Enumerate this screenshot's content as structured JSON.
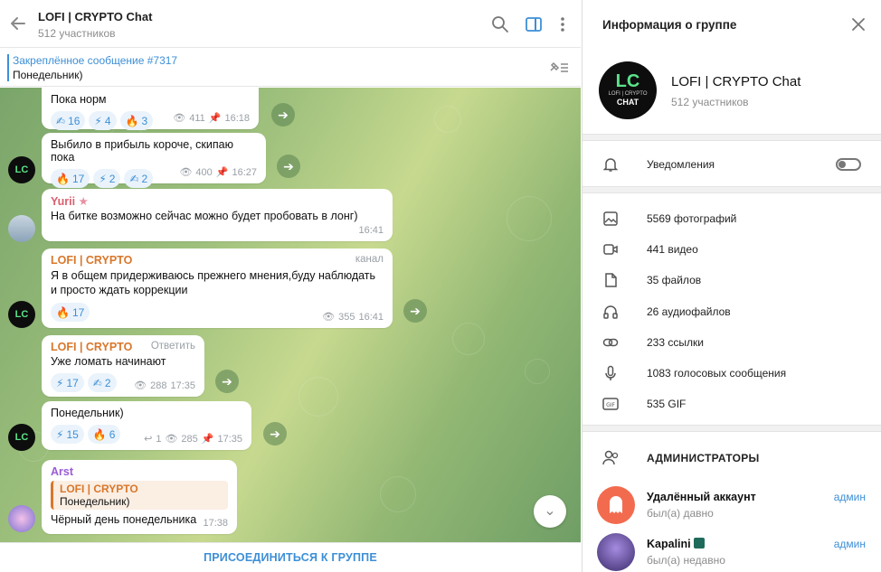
{
  "header": {
    "title": "LOFI | CRYPTO Chat",
    "subtitle": "512 участников"
  },
  "pinned": {
    "title": "Закреплённое сообщение #7317",
    "text": "Понедельник)"
  },
  "messages": [
    {
      "text": "Пока норм",
      "reactions": [
        {
          "emoji": "✍",
          "count": "16"
        },
        {
          "emoji": "⚡",
          "count": "4"
        },
        {
          "emoji": "🔥",
          "count": "3"
        }
      ],
      "views": "411",
      "time": "16:18"
    },
    {
      "text": "Выбило в прибыль короче, скипаю пока",
      "reactions": [
        {
          "emoji": "🔥",
          "count": "17"
        },
        {
          "emoji": "⚡",
          "count": "2"
        },
        {
          "emoji": "✍",
          "count": "2"
        }
      ],
      "views": "400",
      "time": "16:27"
    },
    {
      "author": "Yurii",
      "text": "На битке возможно сейчас можно будет пробовать в лонг)",
      "time": "16:41"
    },
    {
      "author": "LOFI | CRYPTO",
      "tag": "канал",
      "text": "Я в общем придерживаюсь прежнего мнения,буду наблюдать и просто ждать коррекции",
      "reactions": [
        {
          "emoji": "🔥",
          "count": "17"
        }
      ],
      "views": "355",
      "time": "16:41"
    },
    {
      "author": "LOFI | CRYPTO",
      "tag": "Ответить",
      "text": "Уже ломать начинают",
      "reactions": [
        {
          "emoji": "⚡",
          "count": "17"
        },
        {
          "emoji": "✍",
          "count": "2"
        }
      ],
      "views": "288",
      "time": "17:35"
    },
    {
      "text": "Понедельник)",
      "reactions": [
        {
          "emoji": "⚡",
          "count": "15"
        },
        {
          "emoji": "🔥",
          "count": "6"
        }
      ],
      "replies": "1",
      "views": "285",
      "time": "17:35"
    },
    {
      "author": "Arst",
      "quote_author": "LOFI | CRYPTO",
      "quote_text": "Понедельник)",
      "text": "Чёрный день понедельника",
      "time": "17:38"
    }
  ],
  "avatar_text": "LC",
  "join_label": "ПРИСОЕДИНИТЬСЯ К ГРУППЕ",
  "panel": {
    "title": "Информация о группе",
    "group_name": "LOFI | CRYPTO Chat",
    "members": "512 участников",
    "avatar_text_top": "LC",
    "avatar_text_sub": "LOFI | CRYPTO",
    "avatar_text_chat": "CHAT",
    "notifications_label": "Уведомления",
    "media": [
      {
        "icon": "photo-icon",
        "label": "5569 фотографий"
      },
      {
        "icon": "video-icon",
        "label": "441 видео"
      },
      {
        "icon": "file-icon",
        "label": "35 файлов"
      },
      {
        "icon": "headphones-icon",
        "label": "26 аудиофайлов"
      },
      {
        "icon": "link-icon",
        "label": "233 ссылки"
      },
      {
        "icon": "mic-icon",
        "label": "1083 голосовых сообщения"
      },
      {
        "icon": "gif-icon",
        "label": "535 GIF"
      }
    ],
    "admins_title": "АДМИНИСТРАТОРЫ",
    "admins": [
      {
        "name": "Удалённый аккаунт",
        "status": "был(а) давно",
        "role": "админ"
      },
      {
        "name": "Kapalini",
        "status": "был(а) недавно",
        "role": "админ"
      }
    ]
  },
  "colors": {
    "accent": "#3d8fd6",
    "name_lofi": "#d9772b",
    "name_yurii": "#d95f6f",
    "name_arst": "#9a5bd6"
  }
}
